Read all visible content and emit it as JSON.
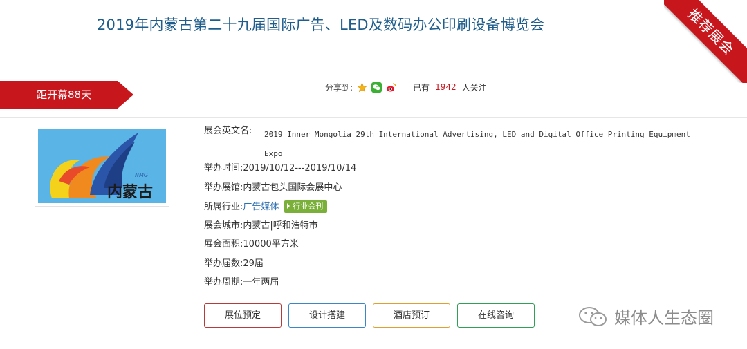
{
  "title": "2019年内蒙古第二十九届国际广告、LED及数码办公印刷设备博览会",
  "ribbon": "推荐展会",
  "countdown": "距开幕88天",
  "share": {
    "label": "分享到:",
    "icons": [
      "star-icon",
      "wechat-icon",
      "weibo-icon"
    ],
    "prefix": "已有",
    "count": "1942",
    "suffix": "人关注"
  },
  "logo": {
    "text": "内蒙古",
    "small": "NMG"
  },
  "info": {
    "en_label": "展会英文名:",
    "en_line1": "2019 Inner Mongolia 29th International Advertising, LED and Digital Office Printing Equipment",
    "en_line2": "Expo",
    "time_label": "举办时间:",
    "time_value": "2019/10/12---2019/10/14",
    "venue_label": "举办展馆:",
    "venue_value": "内蒙古包头国际会展中心",
    "industry_label": "所属行业:",
    "industry_value": "广告媒体",
    "industry_tag": "行业会刊",
    "city_label": "展会城市:",
    "city_value": "内蒙古|呼和浩特市",
    "area_label": "展会面积:",
    "area_value": "10000平方米",
    "sessions_label": "举办届数:",
    "sessions_value": "29届",
    "cycle_label": "举办周期:",
    "cycle_value": "一年两届"
  },
  "buttons": {
    "booth": "展位预定",
    "design": "设计搭建",
    "hotel": "酒店预订",
    "consult": "在线咨询"
  },
  "watermark": "媒体人生态圈",
  "colors": {
    "brand_red": "#c8161d",
    "title_blue": "#1f5e8c",
    "tag_green": "#7ab03a",
    "link_blue": "#2e6fb0"
  }
}
